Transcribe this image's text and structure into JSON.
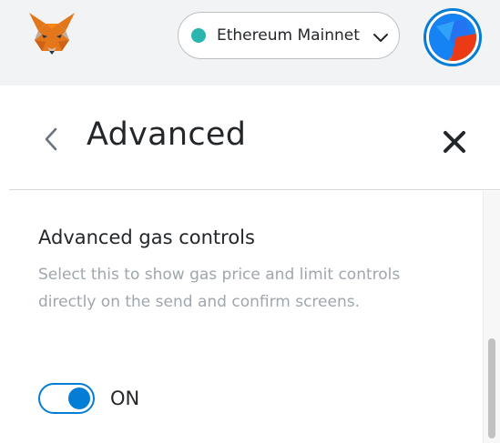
{
  "header": {
    "logo_icon": "metamask-fox-icon",
    "network": {
      "name": "Ethereum Mainnet",
      "dot_color": "#29b6af",
      "chevron_icon": "chevron-down-icon"
    },
    "account_avatar": {
      "icon": "identicon-avatar",
      "ring_color": "#037dd6"
    }
  },
  "page": {
    "title": "Advanced",
    "back_icon": "chevron-left-icon",
    "close_icon": "close-icon"
  },
  "setting": {
    "title": "Advanced gas controls",
    "description": "Select this to show gas price and limit controls directly on the send and confirm screens.",
    "toggle": {
      "state": "ON",
      "on": true,
      "accent": "#037dd6"
    }
  },
  "colors": {
    "header_bg": "#f2f3f4",
    "accent": "#037dd6",
    "muted_text": "#9fa6ae"
  }
}
